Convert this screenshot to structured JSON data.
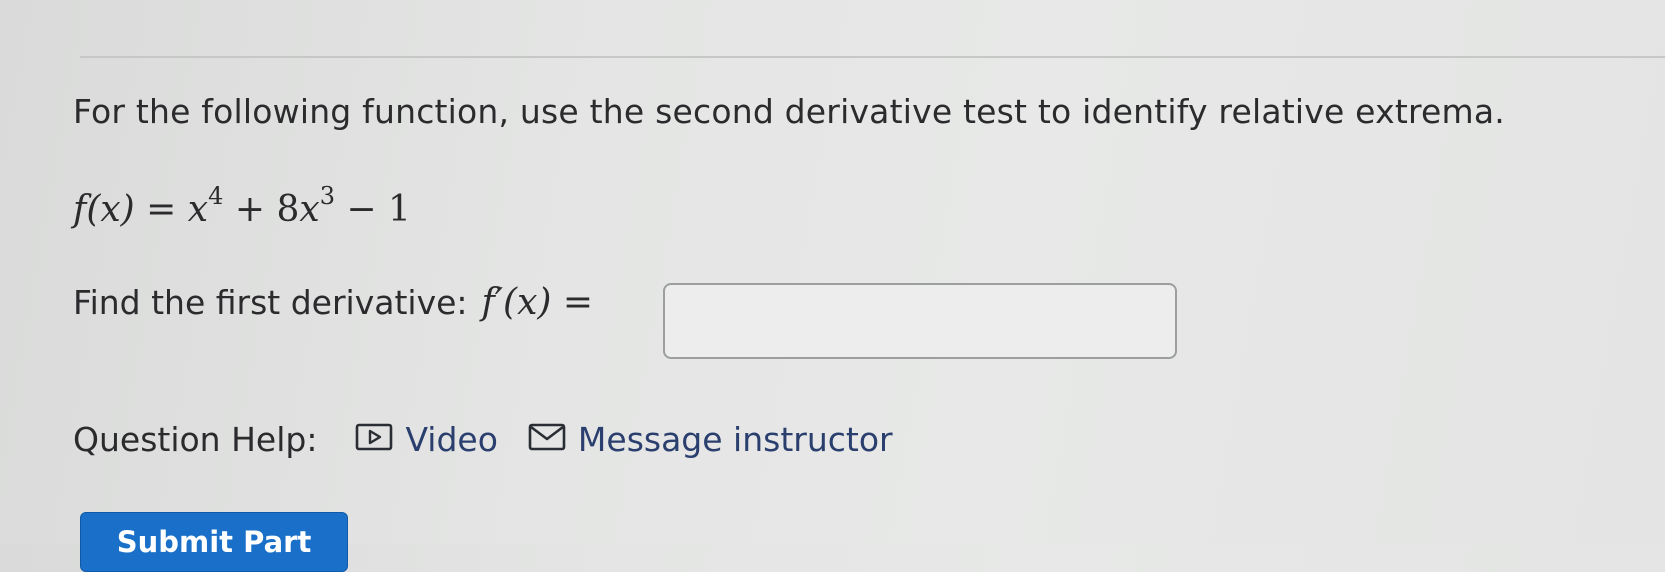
{
  "question": {
    "prompt": "For the following function, use the second derivative test to identify relative extrema."
  },
  "function": {
    "lhs": "f(x)",
    "equals": "=",
    "term1_base": "x",
    "term1_exp": "4",
    "plus": "+",
    "term2_coef": "8",
    "term2_base": "x",
    "term2_exp": "3",
    "minus": "−",
    "constant": "1"
  },
  "derivative": {
    "label": "Find the first derivative:",
    "lhs": "f′(x)",
    "equals": "=",
    "answer_value": ""
  },
  "help": {
    "label": "Question Help:",
    "video_label": "Video",
    "message_label": "Message instructor",
    "video_icon": "play-box-icon",
    "message_icon": "envelope-icon"
  },
  "submit": {
    "label": "Submit Part"
  },
  "colors": {
    "link": "#2a3f6e",
    "button": "#1a70c8",
    "background": "#e4e5e4"
  }
}
